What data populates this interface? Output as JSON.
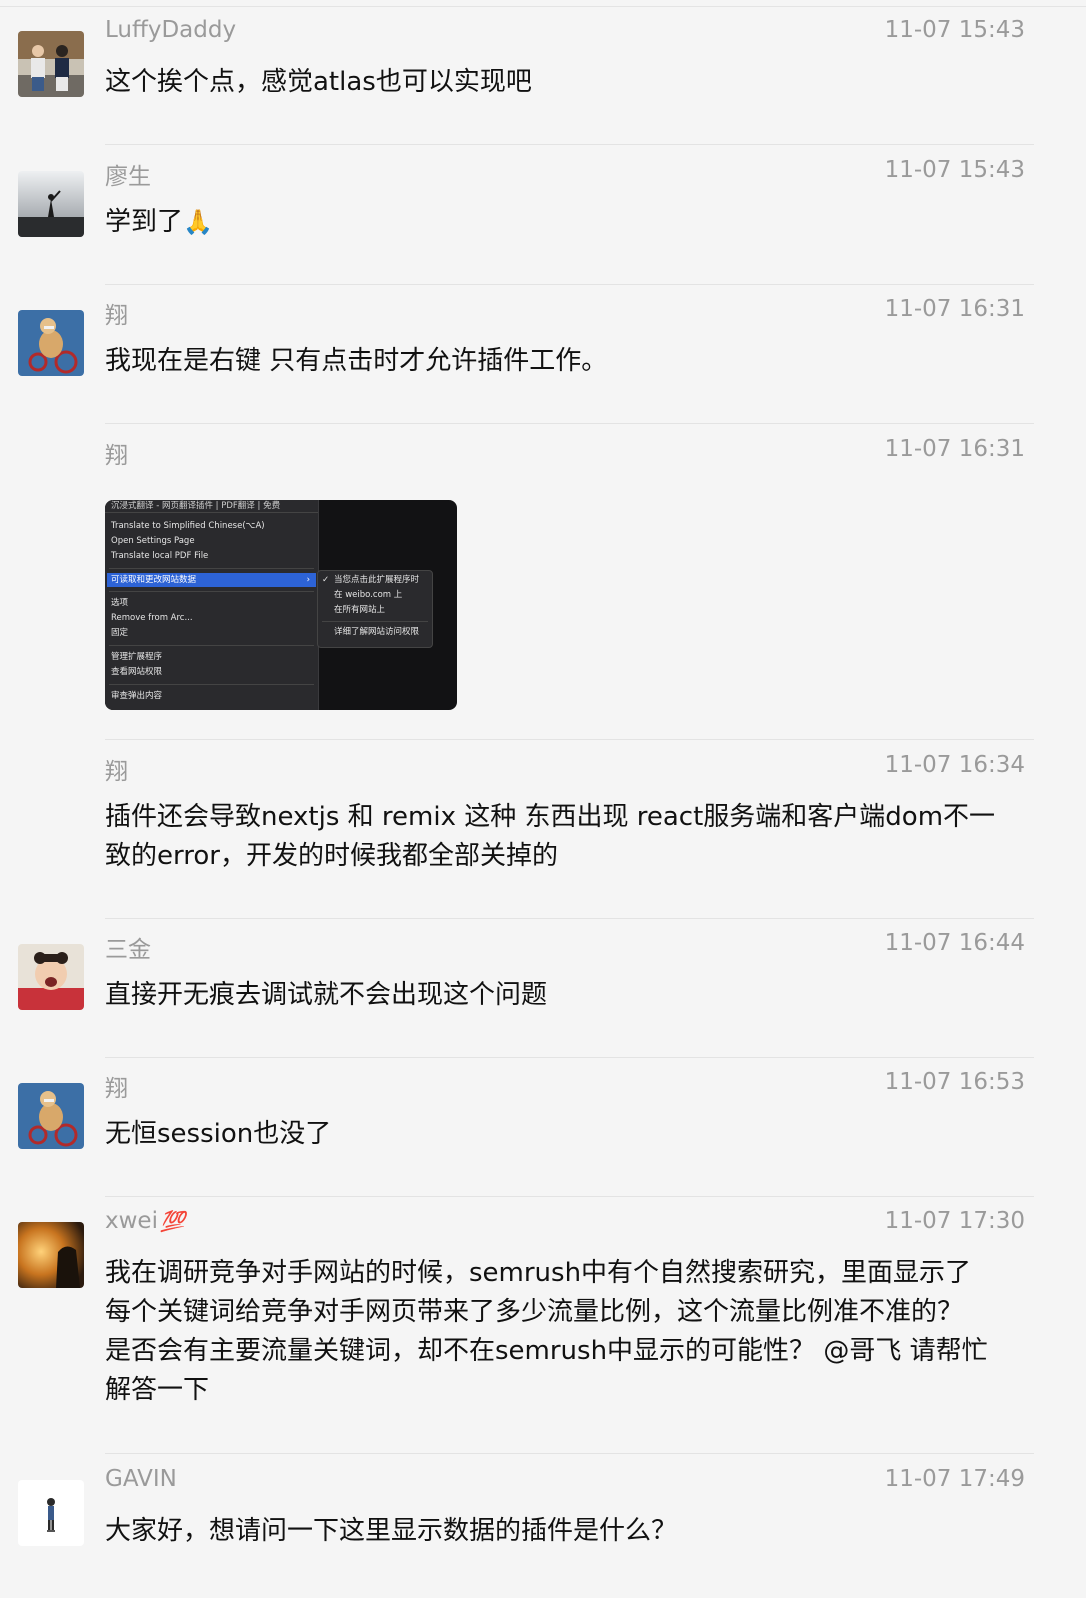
{
  "messages": [
    {
      "name": "LuffyDaddy",
      "time": "11-07 15:43",
      "lines": [
        "这个挨个点，感觉atlas也可以实现吧"
      ]
    },
    {
      "name": "廖生",
      "time": "11-07 15:43",
      "text": "学到了",
      "emoji": "🙏"
    },
    {
      "name": "翔",
      "time": "11-07 16:31",
      "lines": [
        "我现在是右键 只有点击时才允许插件工作。"
      ]
    },
    {
      "name": "翔",
      "time": "11-07 16:31",
      "image": {
        "header": "沉浸式翻译 - 网页翻译插件 | PDF翻译 | 免费",
        "items": [
          "Translate to Simplified Chinese(⌥A)",
          "Open Settings Page",
          "Translate local PDF File"
        ],
        "highlighted": "可读取和更改网站数据",
        "highlighted_arrow": "›",
        "items2": [
          "选项",
          "Remove from Arc...",
          "固定"
        ],
        "items3": [
          "管理扩展程序",
          "查看网站权限"
        ],
        "items4": [
          "审查弹出内容"
        ],
        "submenu": [
          "当您点击此扩展程序时",
          "在 weibo.com 上",
          "在所有网站上"
        ],
        "submenu_check": "✓",
        "submenu_extra": "详细了解网站访问权限"
      }
    },
    {
      "name": "翔",
      "time": "11-07 16:34",
      "lines": [
        "插件还会导致nextjs 和 remix 这种 东西出现 react服务端和客户端dom不一",
        "致的error，开发的时候我都全部关掉的"
      ]
    },
    {
      "name": "三金",
      "time": "11-07 16:44",
      "lines": [
        "直接开无痕去调试就不会出现这个问题"
      ]
    },
    {
      "name": "翔",
      "time": "11-07 16:53",
      "lines": [
        "无恒session也没了"
      ]
    },
    {
      "name": "xwei",
      "name_badge": "💯",
      "time": "11-07 17:30",
      "lines": [
        "我在调研竞争对手网站的时候，semrush中有个自然搜索研究，里面显示了",
        "每个关键词给竞争对手网页带来了多少流量比例，这个流量比例准不准的？",
        "是否会有主要流量关键词，却不在semrush中显示的可能性？ @哥飞 请帮忙",
        "解答一下"
      ]
    },
    {
      "name": "GAVIN",
      "time": "11-07 17:49",
      "lines": [
        "大家好，想请问一下这里显示数据的插件是什么？"
      ]
    }
  ]
}
